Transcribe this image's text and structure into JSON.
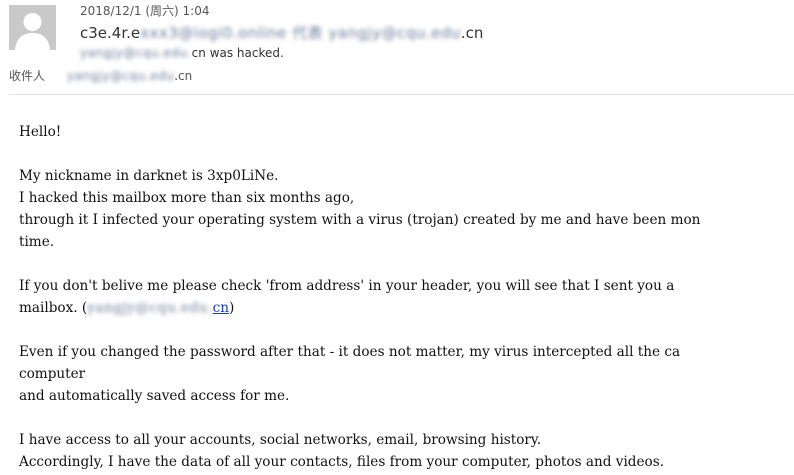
{
  "header": {
    "date": "2018/12/1 (周六) 1:04",
    "from_prefix": "c3e.4r.e",
    "from_blurred": "xxx3@iogi0.online 代表 yangjy@cqu.edu",
    "from_suffix": ".cn",
    "subject_blurred": "yangjy@cqu.edu.",
    "subject_suffix": "cn was hacked.",
    "recipient_label": "收件人",
    "recipient_blurred": "yangjy@cqu.edu",
    "recipient_suffix": ".cn"
  },
  "body": {
    "greeting": "Hello!",
    "p1_l1": "My nickname in darknet is 3xp0LiNe.",
    "p1_l2": "I hacked this mailbox more than six months ago,",
    "p1_l3": "through it I infected your operating system with a virus (trojan) created by me and have been mon",
    "p1_l4": "time.",
    "p2_l1": "If you don't belive me please check 'from address' in your header, you will see that I sent you a",
    "p2_l2_prefix": "mailbox. (",
    "p2_link_blurred": "yangjy@cqu.edu.",
    "p2_link_suffix": "cn",
    "p2_l2_suffix": ")",
    "p3_l1": "Even if you changed the password after that - it does not matter, my virus intercepted all the ca",
    "p3_l2": "computer",
    "p3_l3": "and automatically saved access for me.",
    "p4_l1": "I have access to all your accounts, social networks, email, browsing history.",
    "p4_l2": "Accordingly, I have the data of all your contacts, files from your computer, photos and videos."
  },
  "colors": {
    "avatar_bg": "#c9c9c9",
    "link": "#1a3fb8",
    "divider": "#e3e3e3"
  },
  "icons": {
    "avatar": "person-silhouette-icon"
  }
}
